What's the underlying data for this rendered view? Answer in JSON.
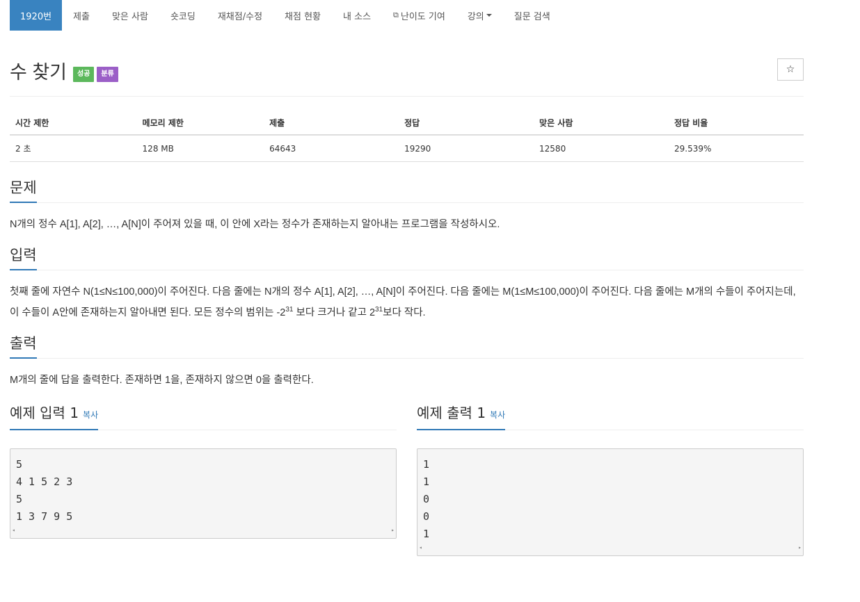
{
  "nav": {
    "items": [
      {
        "label": "1920번",
        "active": true
      },
      {
        "label": "제출"
      },
      {
        "label": "맞은 사람"
      },
      {
        "label": "숏코딩"
      },
      {
        "label": "재채점/수정"
      },
      {
        "label": "채점 현황"
      },
      {
        "label": "내 소스"
      },
      {
        "label": "난이도 기여",
        "icon": "external-link-icon"
      },
      {
        "label": "강의",
        "icon": "caret-down-icon"
      },
      {
        "label": "질문 검색"
      }
    ]
  },
  "problem": {
    "title": "수 찾기",
    "badges": [
      {
        "label": "성공",
        "color": "#5cb85c"
      },
      {
        "label": "분류",
        "color": "#9b5fc7"
      }
    ],
    "star_icon": "☆"
  },
  "info_table": {
    "headers": [
      "시간 제한",
      "메모리 제한",
      "제출",
      "정답",
      "맞은 사람",
      "정답 비율"
    ],
    "values": [
      "2 초",
      "128 MB",
      "64643",
      "19290",
      "12580",
      "29.539%"
    ]
  },
  "sections": {
    "problem": {
      "title": "문제",
      "text": "N개의 정수 A[1], A[2], …, A[N]이 주어져 있을 때, 이 안에 X라는 정수가 존재하는지 알아내는 프로그램을 작성하시오."
    },
    "input": {
      "title": "입력",
      "text_a": "첫째 줄에 자연수 N(1≤N≤100,000)이 주어진다. 다음 줄에는 N개의 정수 A[1], A[2], …, A[N]이 주어진다. 다음 줄에는 M(1≤M≤100,000)이 주어진다. 다음 줄에는 M개의 수들이 주어지는데, 이 수들이 A안에 존재하는지 알아내면 된다. 모든 정수의 범위는 -2",
      "sup_a": "31",
      "text_b": " 보다 크거나 같고 2",
      "sup_b": "31",
      "text_c": "보다 작다."
    },
    "output": {
      "title": "출력",
      "text": "M개의 줄에 답을 출력한다. 존재하면 1을, 존재하지 않으면 0을 출력한다."
    }
  },
  "samples": {
    "input": {
      "title": "예제 입력 1",
      "copy": "복사",
      "content": "5\n4 1 5 2 3\n5\n1 3 7 9 5"
    },
    "output": {
      "title": "예제 출력 1",
      "copy": "복사",
      "content": "1\n1\n0\n0\n1"
    }
  },
  "colors": {
    "nav_active": "#3983c0",
    "accent": "#2f78b6"
  }
}
